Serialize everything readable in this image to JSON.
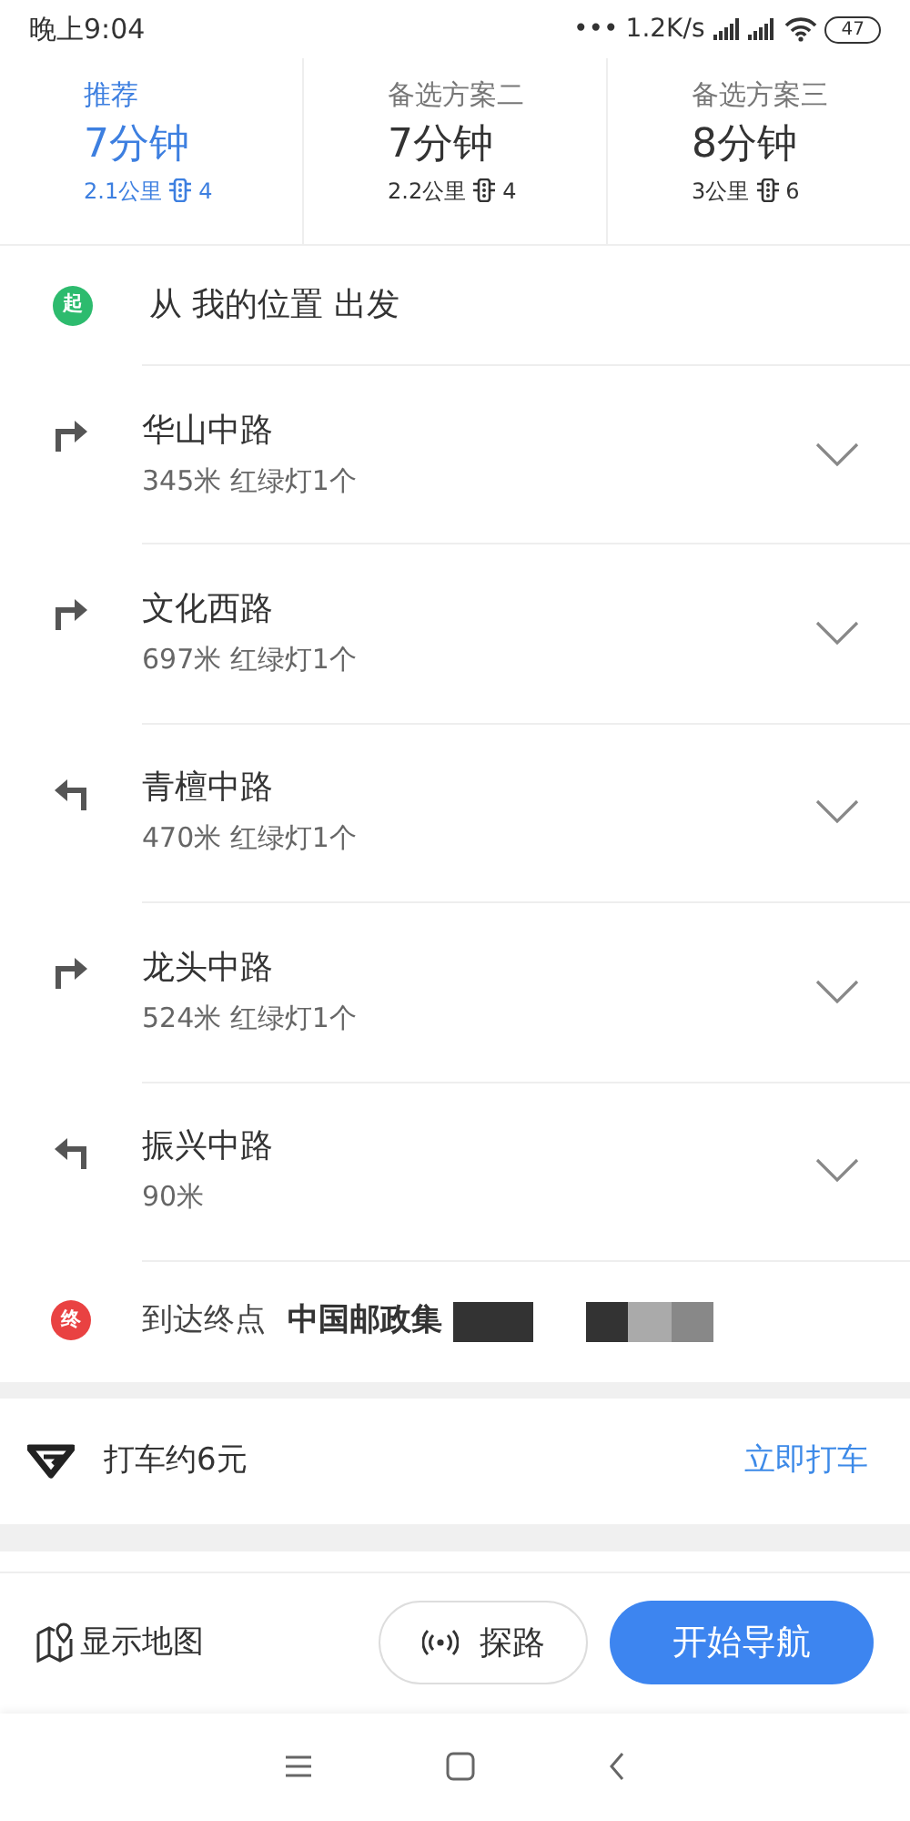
{
  "status_bar": {
    "time": "晚上9:04",
    "notifications": "•••",
    "speed": "1.2K/s",
    "battery": "47"
  },
  "routes": [
    {
      "label": "推荐",
      "duration": "7分钟",
      "distance": "2.1公里",
      "lights": "4",
      "selected": true
    },
    {
      "label": "备选方案二",
      "duration": "7分钟",
      "distance": "2.2公里",
      "lights": "4",
      "selected": false
    },
    {
      "label": "备选方案三",
      "duration": "8分钟",
      "distance": "3公里",
      "lights": "6",
      "selected": false
    }
  ],
  "start": {
    "badge": "起",
    "prefix": "从",
    "place": "我的位置",
    "suffix": "出发"
  },
  "steps": [
    {
      "kind": "right",
      "road": "华山中路",
      "detail": "345米 红绿灯1个"
    },
    {
      "kind": "right",
      "road": "文化西路",
      "detail": "697米 红绿灯1个"
    },
    {
      "kind": "left",
      "road": "青檀中路",
      "detail": "470米 红绿灯1个"
    },
    {
      "kind": "right",
      "road": "龙头中路",
      "detail": "524米 红绿灯1个"
    },
    {
      "kind": "left",
      "road": "振兴中路",
      "detail": "90米"
    }
  ],
  "end": {
    "badge": "终",
    "prefix": "到达终点",
    "place": "中国邮政集"
  },
  "taxi": {
    "label": "打车约6元",
    "action": "立即打车"
  },
  "bottom_bar": {
    "map": "显示地图",
    "explore": "探路",
    "navigate": "开始导航"
  }
}
